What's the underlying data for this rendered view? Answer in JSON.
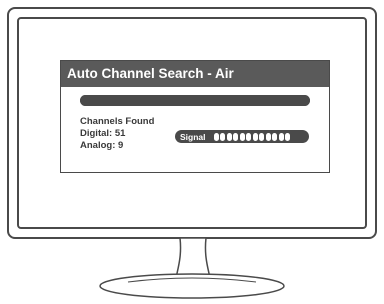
{
  "dialog": {
    "title": "Auto Channel Search - Air",
    "progress": 1.0
  },
  "results": {
    "heading": "Channels Found",
    "digital": "Digital: 51",
    "analog": "Analog: 9"
  },
  "signal": {
    "label": "Signal",
    "segments_total": 12,
    "segments_lit": 12
  },
  "colors": {
    "frame": "#4a4a4a",
    "title_bar": "#5a5a5a",
    "text": "#3a3a3a"
  }
}
